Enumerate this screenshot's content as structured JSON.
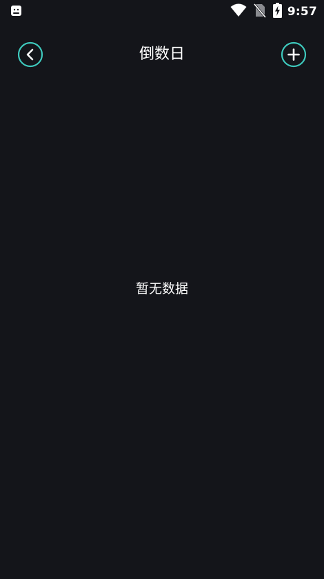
{
  "status_bar": {
    "time": "9:57",
    "icons": [
      "app-notification-icon",
      "wifi-icon",
      "no-sim-icon",
      "battery-charging-icon"
    ]
  },
  "header": {
    "title": "倒数日",
    "back_icon": "chevron-left-icon",
    "add_icon": "plus-icon",
    "accent_color": "#3ec9bd"
  },
  "main": {
    "empty_text": "暂无数据"
  },
  "colors": {
    "background": "#14151a",
    "text": "#ffffff",
    "accent": "#3ec9bd"
  }
}
